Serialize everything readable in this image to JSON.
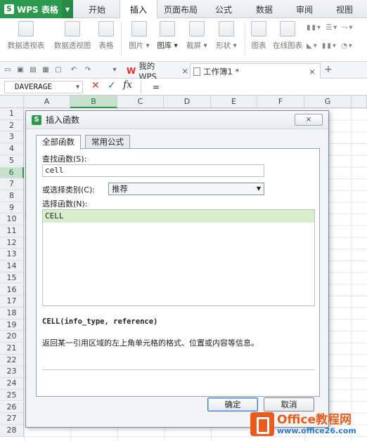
{
  "app": {
    "name": "WPS 表格",
    "logo_letter": "S"
  },
  "menu": {
    "tabs": [
      {
        "label": "开始"
      },
      {
        "label": "插入",
        "active": true
      },
      {
        "label": "页面布局"
      },
      {
        "label": "公式"
      },
      {
        "label": "数据"
      },
      {
        "label": "审阅"
      },
      {
        "label": "视图"
      }
    ]
  },
  "ribbon": {
    "buttons": [
      {
        "label": "数据透视表",
        "icon": "pivot-table-icon"
      },
      {
        "label": "数据透视图",
        "icon": "pivot-chart-icon"
      },
      {
        "label": "表格",
        "icon": "table-icon"
      },
      {
        "label": "图片 ▾",
        "icon": "picture-icon"
      },
      {
        "label": "图库 ▾",
        "icon": "gallery-icon"
      },
      {
        "label": "截屏 ▾",
        "icon": "screenshot-icon"
      },
      {
        "label": "形状 ▾",
        "icon": "shapes-icon"
      },
      {
        "label": "图表",
        "icon": "chart-icon"
      },
      {
        "label": "在线图表",
        "icon": "online-chart-icon"
      }
    ]
  },
  "doc_tabs": {
    "home": "我的WPS",
    "file": "工作簿1 *",
    "close_glyph": "×",
    "add_glyph": "+"
  },
  "formula_bar": {
    "name_box": "DAVERAGE",
    "cancel_glyph": "✕",
    "confirm_glyph": "✓",
    "fx_label": "fx",
    "content": "="
  },
  "grid": {
    "columns": [
      "A",
      "B",
      "C",
      "D",
      "E",
      "F",
      "G"
    ],
    "selected_column": "B",
    "rows": [
      "1",
      "2",
      "3",
      "4",
      "5",
      "6",
      "7",
      "8",
      "9",
      "10",
      "11",
      "12",
      "13",
      "14",
      "15",
      "16",
      "17",
      "18",
      "19",
      "20",
      "21",
      "22",
      "23",
      "24",
      "25",
      "26",
      "27",
      "28"
    ],
    "selected_row": "6"
  },
  "dialog": {
    "title": "插入函数",
    "close_glyph": "⨯",
    "tabs": [
      {
        "label": "全部函数",
        "active": true
      },
      {
        "label": "常用公式"
      }
    ],
    "search_label": "查找函数(S):",
    "search_value": "cell",
    "category_label": "或选择类别(C):",
    "category_value": "推荐",
    "function_list_label": "选择函数(N):",
    "functions": [
      "CELL"
    ],
    "selected_function": "CELL",
    "signature": "CELL(info_type, reference)",
    "description": "返回某一引用区域的左上角单元格的格式、位置或内容等信息。",
    "ok_label": "确定",
    "cancel_label": "取消"
  },
  "watermark": {
    "line1": "Office教程网",
    "line2": "www.office26.com"
  }
}
